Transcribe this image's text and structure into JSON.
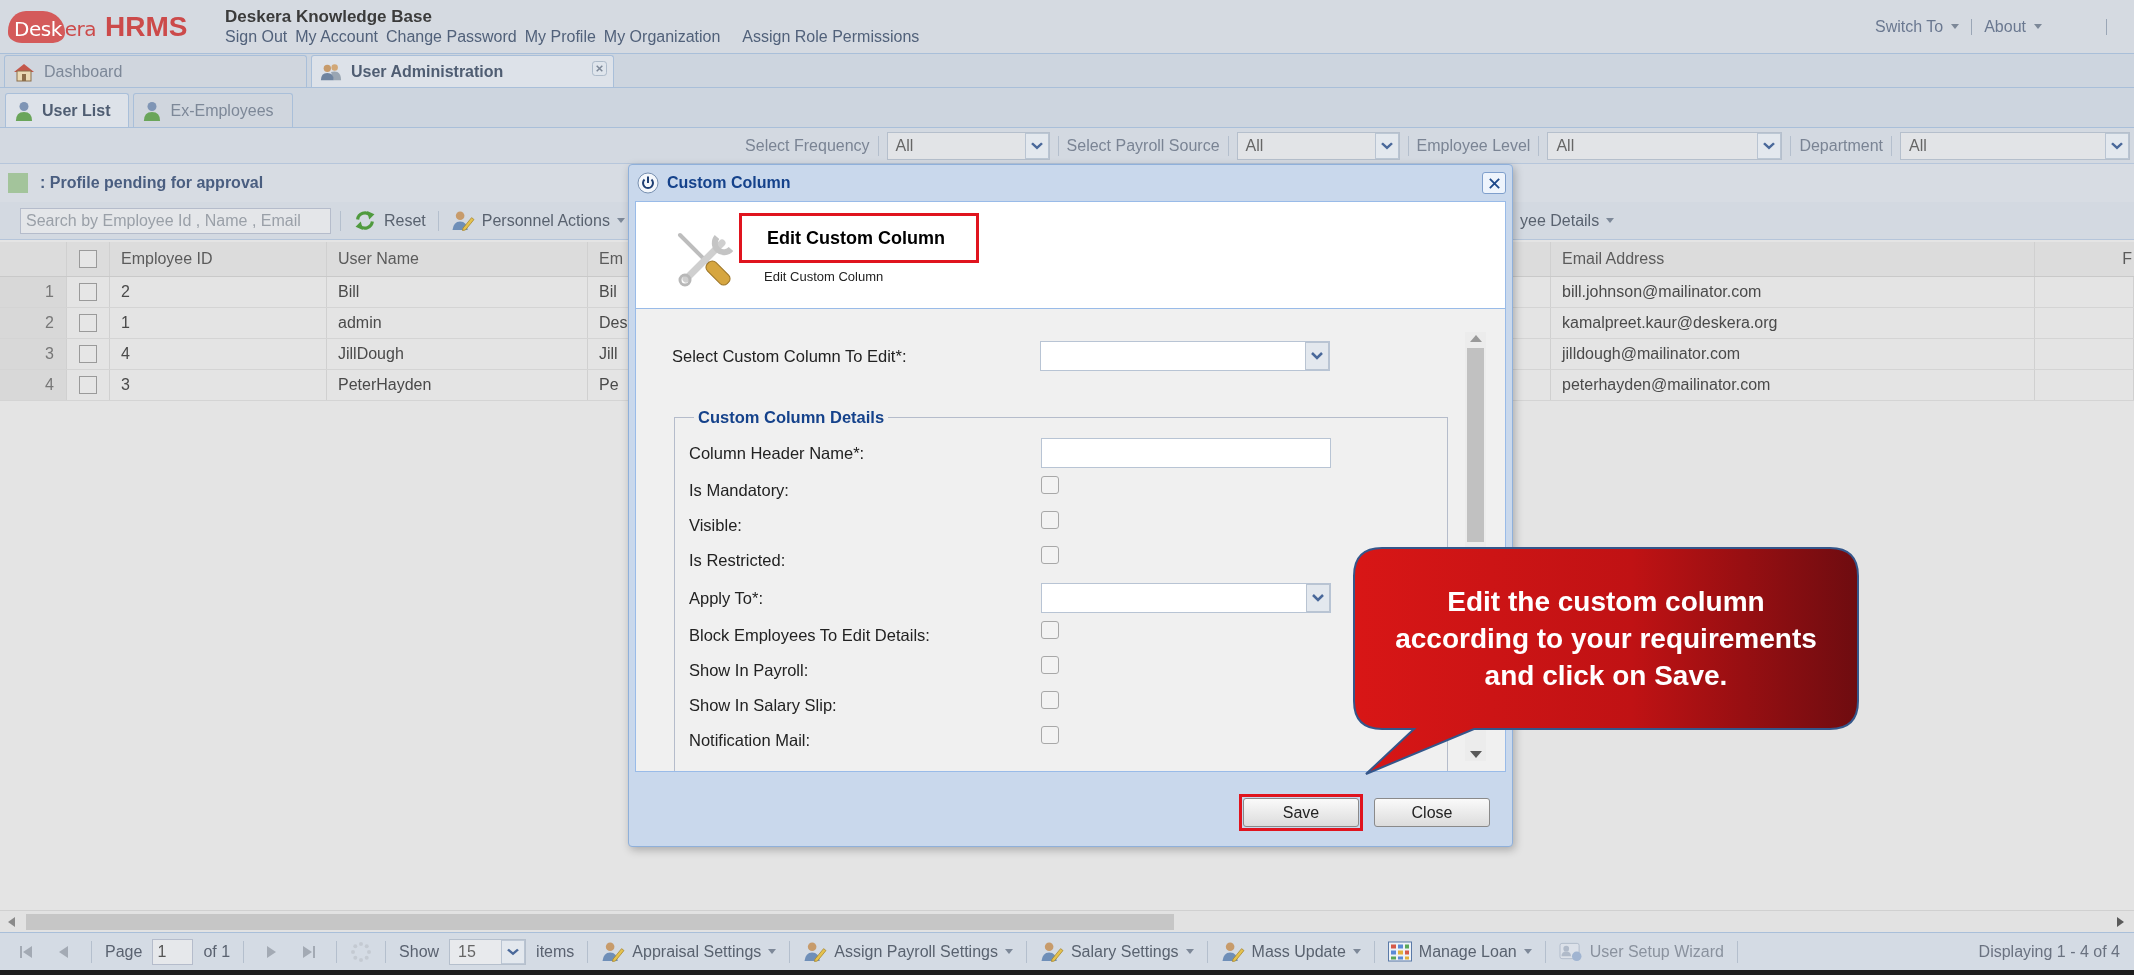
{
  "header": {
    "logo": {
      "cloud_text": "Desk",
      "text": "era",
      "product": "HRMS"
    },
    "title": "Deskera Knowledge Base",
    "links": [
      "Sign Out",
      "My Account",
      "Change Password",
      "My Profile",
      "My Organization",
      "Assign Role Permissions"
    ],
    "menus": [
      "Switch To",
      "About"
    ]
  },
  "tabs": [
    {
      "label": "Dashboard",
      "selected": false,
      "closable": false
    },
    {
      "label": "User Administration",
      "selected": true,
      "closable": true
    }
  ],
  "subtabs": [
    {
      "label": "User List",
      "selected": true
    },
    {
      "label": "Ex-Employees",
      "selected": false
    }
  ],
  "filters": [
    {
      "label": "Select Frequency",
      "value": "All"
    },
    {
      "label": "Select Payroll Source",
      "value": "All"
    },
    {
      "label": "Employee Level",
      "value": "All"
    },
    {
      "label": "Department",
      "value": "All"
    }
  ],
  "legend": {
    "color": "#a3c49b",
    "text": ": Profile pending for approval"
  },
  "toolbar": {
    "search": {
      "placeholder": "Search by Employee Id , Name , Email"
    },
    "buttons": [
      {
        "label": "Reset",
        "dropdown": false
      },
      {
        "label": "Personnel Actions",
        "dropdown": true
      }
    ],
    "right_buttons": [
      {
        "label": "yee Details",
        "dropdown": true
      }
    ]
  },
  "grid": {
    "all_checked": false,
    "columns": [
      "Employee ID",
      "User Name",
      "Em",
      "Email Address",
      "F"
    ],
    "rows": [
      {
        "number": "1",
        "checked": false,
        "cells": [
          "2",
          "Bill",
          "Bil",
          "bill.johnson@mailinator.com"
        ]
      },
      {
        "number": "2",
        "checked": false,
        "cells": [
          "1",
          "admin",
          "Des",
          "kamalpreet.kaur@deskera.org"
        ]
      },
      {
        "number": "3",
        "checked": false,
        "cells": [
          "4",
          "JillDough",
          "Jill",
          "jilldough@mailinator.com"
        ]
      },
      {
        "number": "4",
        "checked": false,
        "cells": [
          "3",
          "PeterHayden",
          "Pe",
          "peterhayden@mailinator.com"
        ]
      }
    ]
  },
  "dialog": {
    "title": "Custom Column",
    "heading": {
      "title": "Edit Custom Column",
      "subtitle": "Edit Custom Column",
      "highlighted": true
    },
    "select": {
      "label": "Select Custom Column To Edit*:"
    },
    "fieldset": {
      "legend": "Custom Column Details",
      "fields": [
        {
          "kind": "text",
          "label": "Column Header Name*:"
        },
        {
          "kind": "checkbox",
          "label": "Is Mandatory:",
          "checked": false
        },
        {
          "kind": "checkbox",
          "label": "Visible:",
          "checked": false
        },
        {
          "kind": "checkbox",
          "label": "Is Restricted:",
          "checked": false
        },
        {
          "kind": "combo",
          "label": "Apply To*:"
        },
        {
          "kind": "checkbox",
          "label": "Block Employees To Edit Details:",
          "checked": false
        },
        {
          "kind": "checkbox",
          "label": "Show In Payroll:",
          "checked": false
        },
        {
          "kind": "checkbox",
          "label": "Show In Salary Slip:",
          "checked": false
        },
        {
          "kind": "checkbox",
          "label": "Notification Mail:",
          "checked": false
        }
      ]
    },
    "buttons": [
      {
        "label": "Save",
        "highlighted": true
      },
      {
        "label": "Close",
        "highlighted": false
      }
    ]
  },
  "callout": {
    "text": "Edit the custom column\naccording to your requirements\nand click on Save."
  },
  "pager": {
    "page_label": "Page",
    "page": "1",
    "page_count": "of 1",
    "show_label": "Show",
    "page_size": "15",
    "items_label": "items",
    "buttons": [
      {
        "label": "Appraisal Settings",
        "dropdown": true,
        "disabled": false
      },
      {
        "label": "Assign Payroll Settings",
        "dropdown": true,
        "disabled": false
      },
      {
        "label": "Salary Settings",
        "dropdown": true,
        "disabled": false
      },
      {
        "label": "Mass Update",
        "dropdown": true,
        "disabled": false
      },
      {
        "label": "Manage Loan",
        "dropdown": true,
        "disabled": false
      },
      {
        "label": "User Setup Wizard",
        "dropdown": false,
        "disabled": true
      }
    ],
    "status": "Displaying 1 - 4 of 4"
  }
}
